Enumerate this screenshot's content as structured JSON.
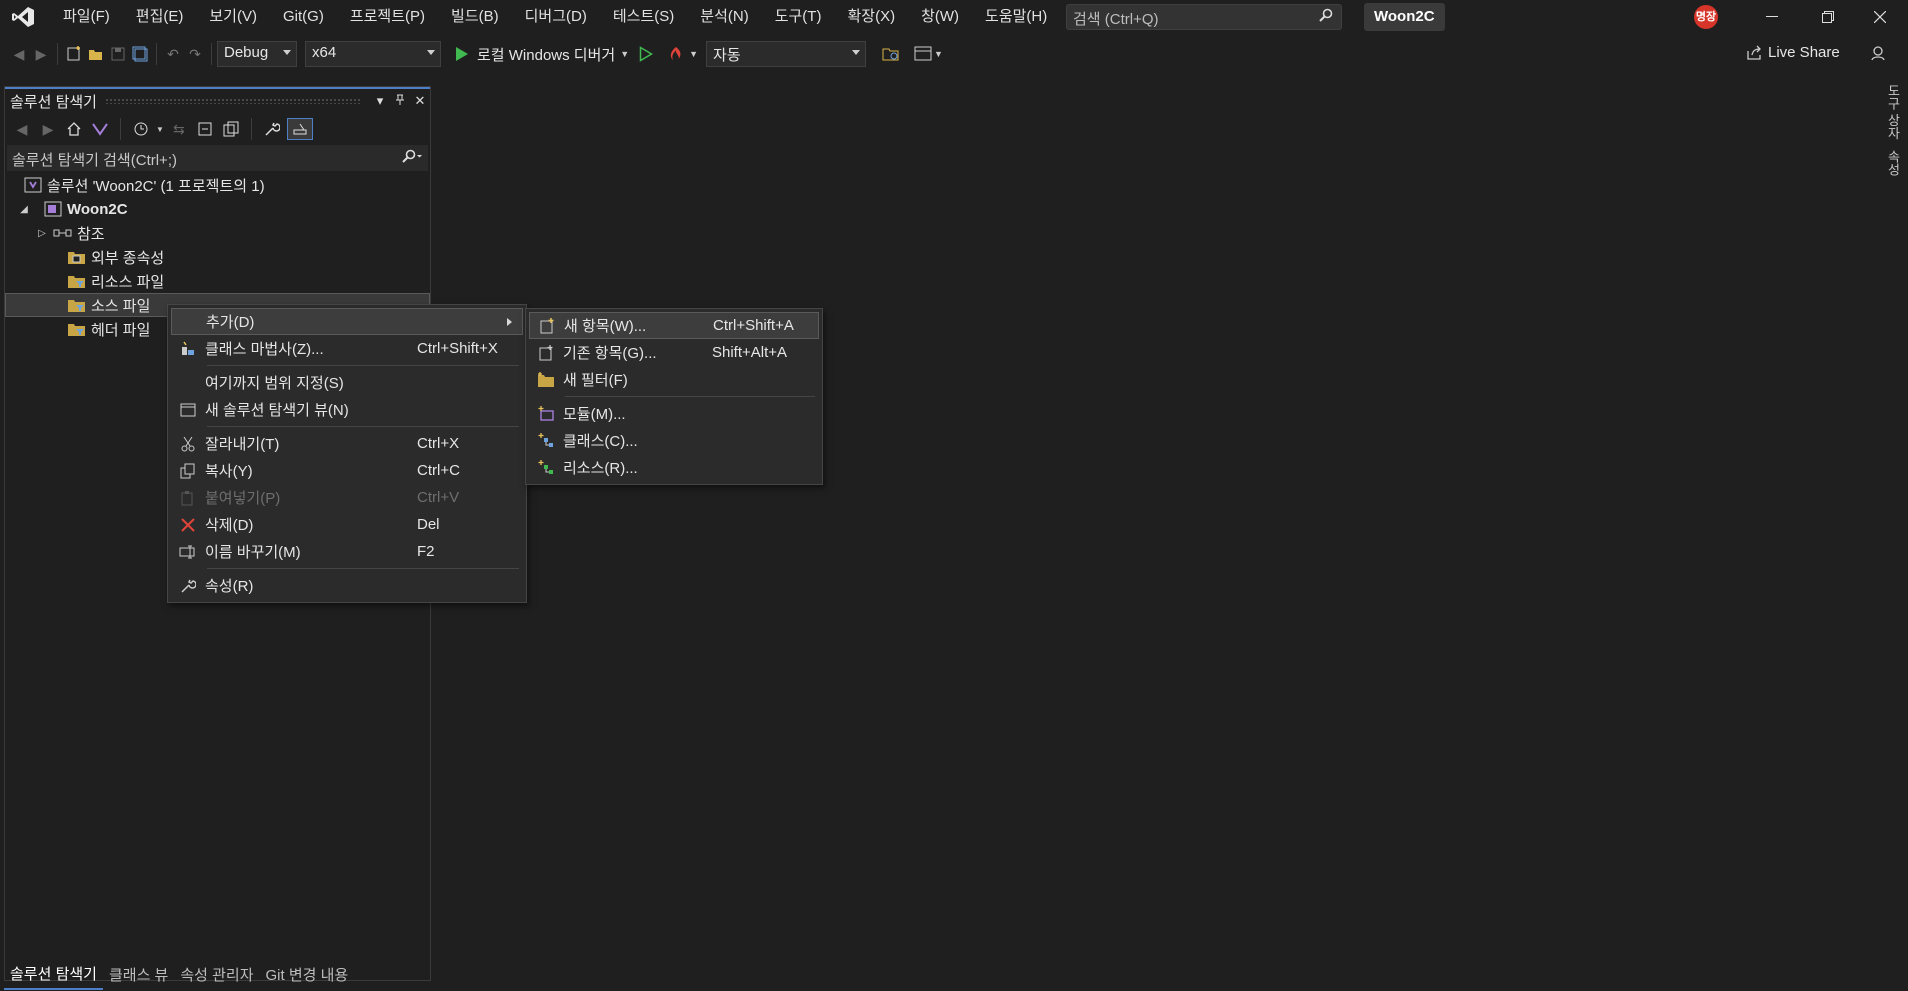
{
  "menubar": {
    "items": [
      "파일(F)",
      "편집(E)",
      "보기(V)",
      "Git(G)",
      "프로젝트(P)",
      "빌드(B)",
      "디버그(D)",
      "테스트(S)",
      "분석(N)",
      "도구(T)",
      "확장(X)",
      "창(W)",
      "도움말(H)"
    ],
    "search_placeholder": "검색 (Ctrl+Q)",
    "solution_name": "Woon2C",
    "avatar_text": "명장"
  },
  "toolbar": {
    "config": "Debug",
    "platform": "x64",
    "debugger": "로컬 Windows 디버거",
    "auto": "자동",
    "live_share": "Live Share"
  },
  "explorer": {
    "title": "솔루션 탐색기",
    "search_placeholder": "솔루션 탐색기 검색(Ctrl+;)",
    "tree": {
      "solution": "솔루션 'Woon2C' (1 프로젝트의 1)",
      "project": "Woon2C",
      "references": "참조",
      "external": "외부 종속성",
      "resources": "리소스 파일",
      "sources": "소스 파일",
      "headers": "헤더 파일"
    },
    "bottom_tabs": [
      "솔루션 탐색기",
      "클래스 뷰",
      "속성 관리자",
      "Git 변경 내용"
    ]
  },
  "right_strip": [
    "도구 상자",
    "속성"
  ],
  "context_menu": {
    "add": "추가(D)",
    "class_wizard": "클래스 마법사(Z)...",
    "class_wizard_key": "Ctrl+Shift+X",
    "scope": "여기까지 범위 지정(S)",
    "new_view": "새 솔루션 탐색기 뷰(N)",
    "cut": "잘라내기(T)",
    "cut_key": "Ctrl+X",
    "copy": "복사(Y)",
    "copy_key": "Ctrl+C",
    "paste": "붙여넣기(P)",
    "paste_key": "Ctrl+V",
    "delete": "삭제(D)",
    "delete_key": "Del",
    "rename": "이름 바꾸기(M)",
    "rename_key": "F2",
    "properties": "속성(R)"
  },
  "submenu": {
    "new_item": "새 항목(W)...",
    "new_item_key": "Ctrl+Shift+A",
    "existing_item": "기존 항목(G)...",
    "existing_item_key": "Shift+Alt+A",
    "new_filter": "새 필터(F)",
    "module": "모듈(M)...",
    "class": "클래스(C)...",
    "resource": "리소스(R)..."
  },
  "colors": {
    "background": "#1f1f1f",
    "accent": "#4d7fc8",
    "vs_purple": "#a47ed8",
    "run_green": "#3fb950",
    "delete_red": "#e0443a"
  }
}
